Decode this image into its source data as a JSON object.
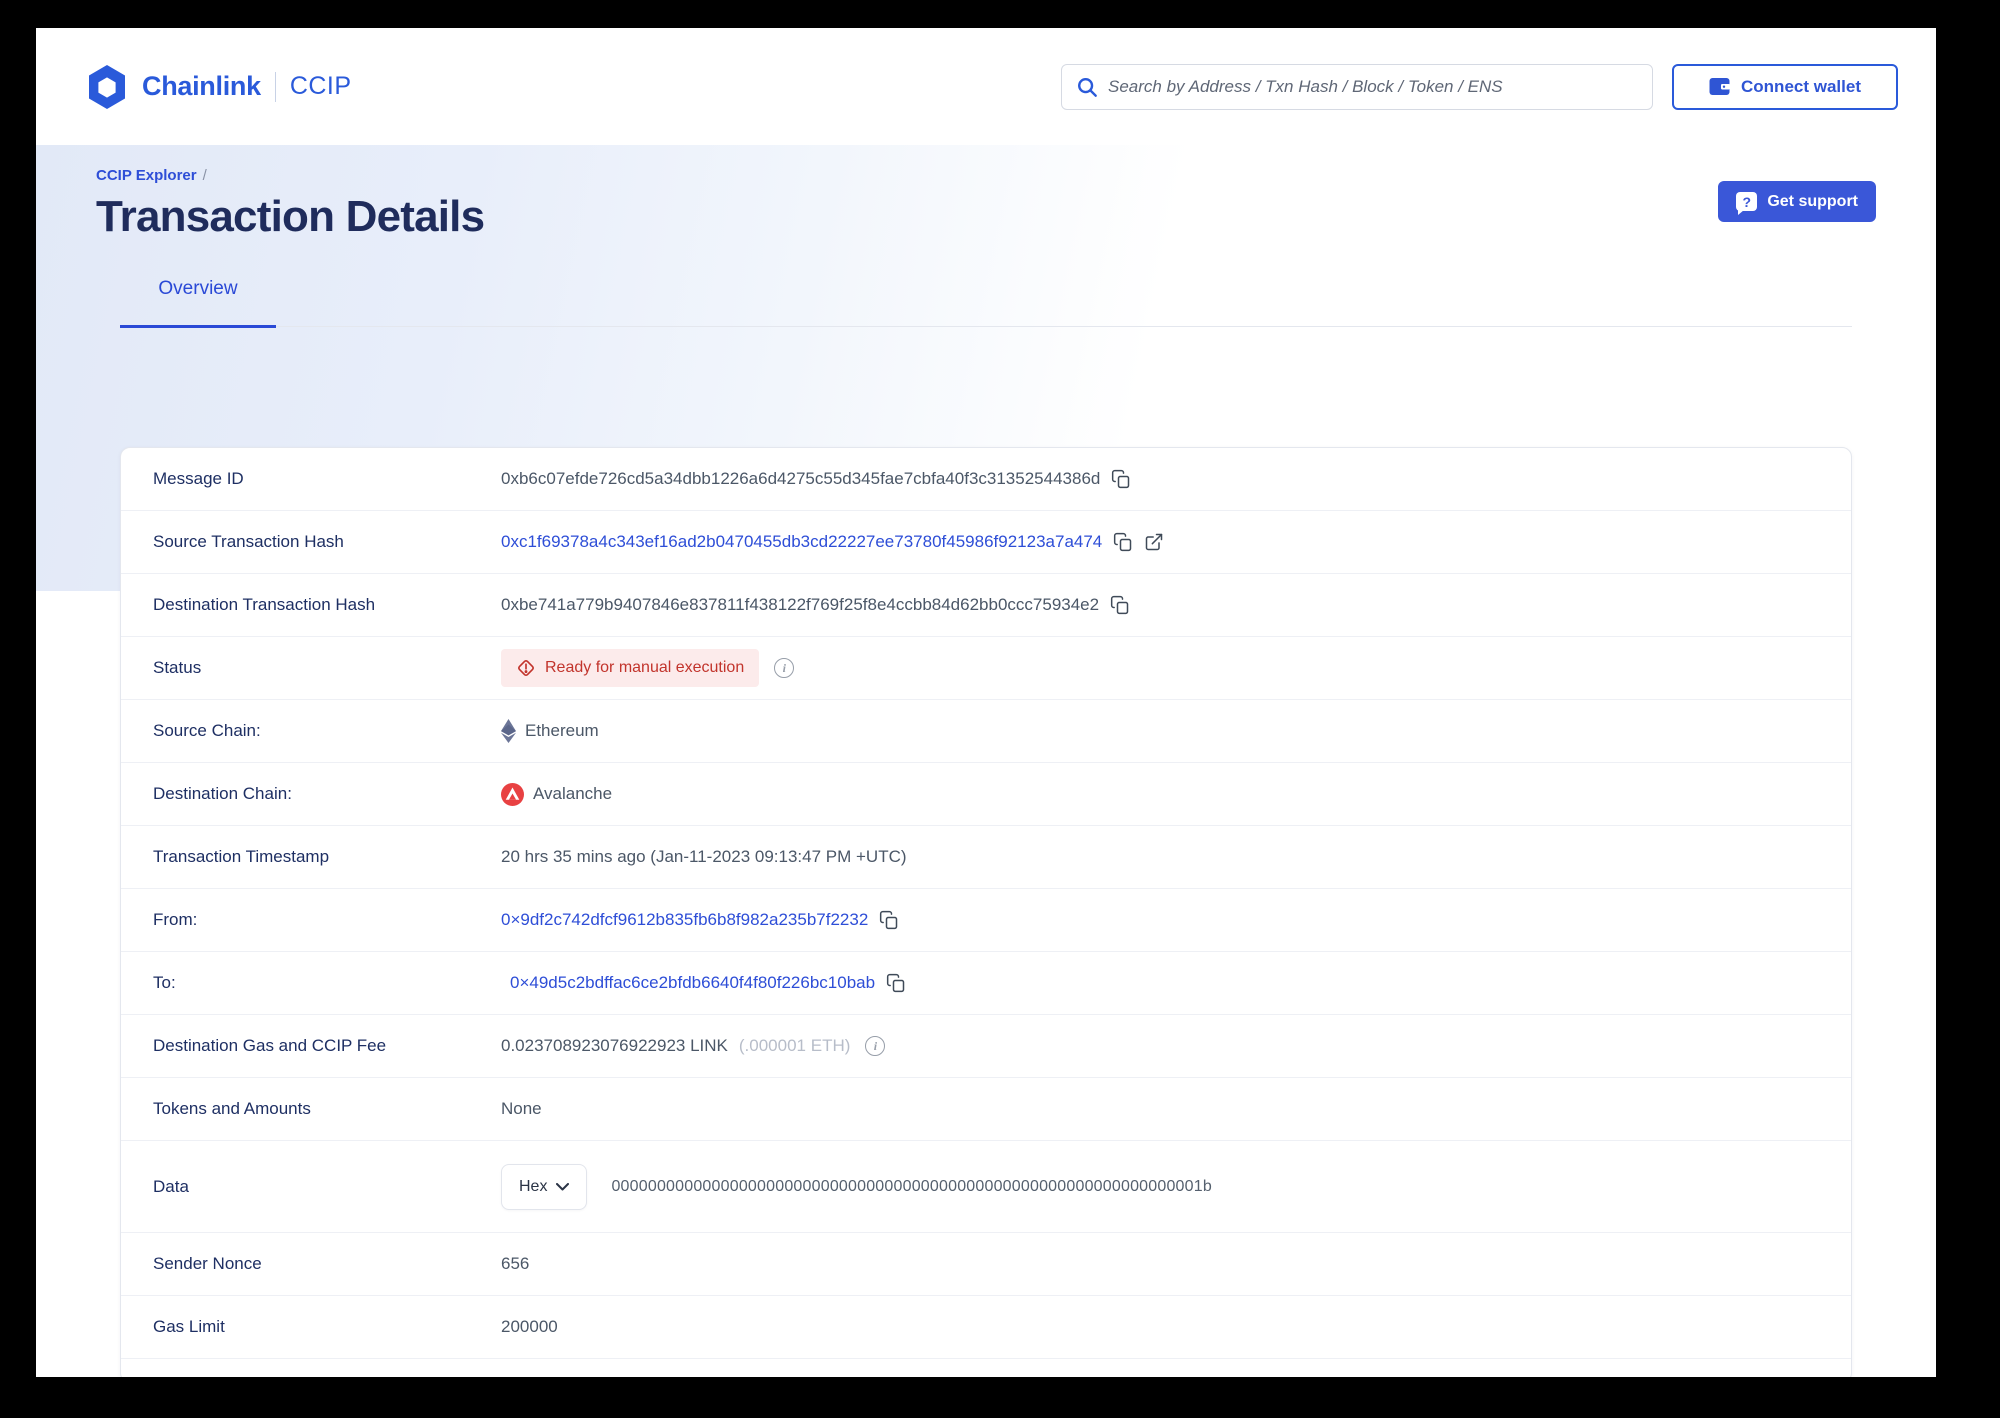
{
  "header": {
    "brand": {
      "name": "Chainlink",
      "product": "CCIP"
    },
    "search": {
      "placeholder": "Search by Address / Txn Hash / Block / Token / ENS"
    },
    "connect_wallet_label": "Connect wallet"
  },
  "hero": {
    "breadcrumb": {
      "link": "CCIP Explorer",
      "separator": "/"
    },
    "title": "Transaction Details",
    "get_support_label": "Get support"
  },
  "tabs": {
    "overview_label": "Overview"
  },
  "details": {
    "message_id": {
      "label": "Message ID",
      "value": "0xb6c07efde726cd5a34dbb1226a6d4275c55d345fae7cbfa40f3c31352544386d"
    },
    "source_tx": {
      "label": "Source Transaction Hash",
      "value": "0xc1f69378a4c343ef16ad2b0470455db3cd22227ee73780f45986f92123a7a474"
    },
    "dest_tx": {
      "label": "Destination Transaction Hash",
      "value": "0xbe741a779b9407846e837811f438122f769f25f8e4ccbb84d62bb0ccc75934e2"
    },
    "status": {
      "label": "Status",
      "badge": "Ready for manual execution"
    },
    "source_chain": {
      "label": "Source Chain:",
      "value": "Ethereum"
    },
    "dest_chain": {
      "label": "Destination Chain:",
      "value": "Avalanche"
    },
    "timestamp": {
      "label": "Transaction Timestamp",
      "value": "20 hrs 35 mins ago (Jan-11-2023 09:13:47 PM +UTC)"
    },
    "from": {
      "label": "From:",
      "value": "0×9df2c742dfcf9612b835fb6b8f982a235b7f2232"
    },
    "to": {
      "label": "To:",
      "value": "0×49d5c2bdffac6ce2bfdb6640f4f80f226bc10bab"
    },
    "fee": {
      "label": "Destination Gas and CCIP Fee",
      "value": "0.023708923076922923 LINK",
      "value_secondary": "(.000001 ETH)"
    },
    "tokens": {
      "label": "Tokens and Amounts",
      "value": "None"
    },
    "data": {
      "label": "Data",
      "format": "Hex",
      "value": "00000000000000000000000000000000000000000000000000000000000000001b"
    },
    "sender_nonce": {
      "label": "Sender Nonce",
      "value": "656"
    },
    "gas_limit": {
      "label": "Gas Limit",
      "value": "200000"
    }
  },
  "icons": {
    "logo": "chainlink-hexagon",
    "search": "magnifying-glass",
    "wallet": "wallet",
    "support": "question-speech-bubble",
    "copy": "copy-pages",
    "external": "arrow-out-of-box",
    "warning": "diamond-exclamation",
    "info": "circle-i",
    "ethereum": "ethereum-diamond",
    "avalanche": "avalanche-red-circle",
    "dropdown": "chevron-down"
  },
  "colors": {
    "brand_blue": "#2a5ada",
    "link_blue": "#2e4ed7",
    "heading_navy": "#1f2c5c",
    "error_red": "#c2342c",
    "error_bg": "#fcebeb",
    "avalanche_red": "#e84142"
  }
}
